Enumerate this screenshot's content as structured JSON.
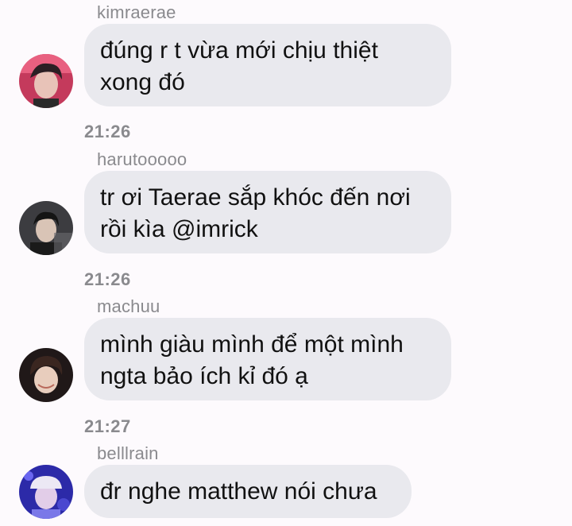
{
  "messages": [
    {
      "user": "kimraerae",
      "lines": [
        "đúng r t vừa mới chịu thiệt",
        "xong đó"
      ],
      "time": "21:26",
      "avatar_icon": "user-avatar-photo"
    },
    {
      "user": "harutooooo",
      "lines": [
        "tr ơi Taerae sắp khóc đến nơi",
        "rồi kìa @imrick"
      ],
      "time": "21:26",
      "avatar_icon": "user-avatar-photo"
    },
    {
      "user": "machuu",
      "lines": [
        "mình giàu mình để một mình",
        "ngta bảo ích kỉ đó ạ"
      ],
      "time": "21:27",
      "avatar_icon": "user-avatar-photo"
    },
    {
      "user": "belllrain",
      "lines": [
        "đr nghe matthew nói chưa"
      ],
      "avatar_icon": "user-avatar-photo"
    }
  ],
  "colors": {
    "background": "#fdfafd",
    "bubble": "#e9e9ee",
    "meta_text": "#8a8a8e",
    "message_text": "#111111"
  }
}
